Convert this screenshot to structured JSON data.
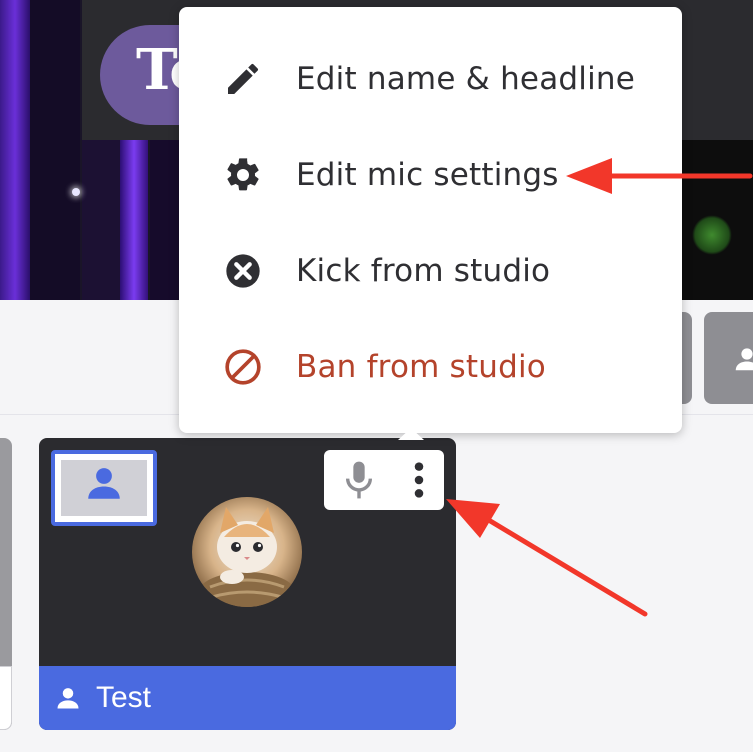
{
  "video": {
    "title_fragment": "To"
  },
  "menu": {
    "items": [
      {
        "label": "Edit name & headline",
        "icon": "pencil-icon"
      },
      {
        "label": "Edit mic settings",
        "icon": "gear-icon"
      },
      {
        "label": "Kick from studio",
        "icon": "close-circle-icon"
      },
      {
        "label": "Ban from studio",
        "icon": "block-icon"
      }
    ],
    "danger_color": "#b4432b"
  },
  "participant": {
    "name": "Test",
    "accent_color": "#4a6ae0",
    "controls": [
      "microphone-icon",
      "more-vertical-icon"
    ]
  },
  "annotation": {
    "arrow_color": "#f2372a"
  }
}
